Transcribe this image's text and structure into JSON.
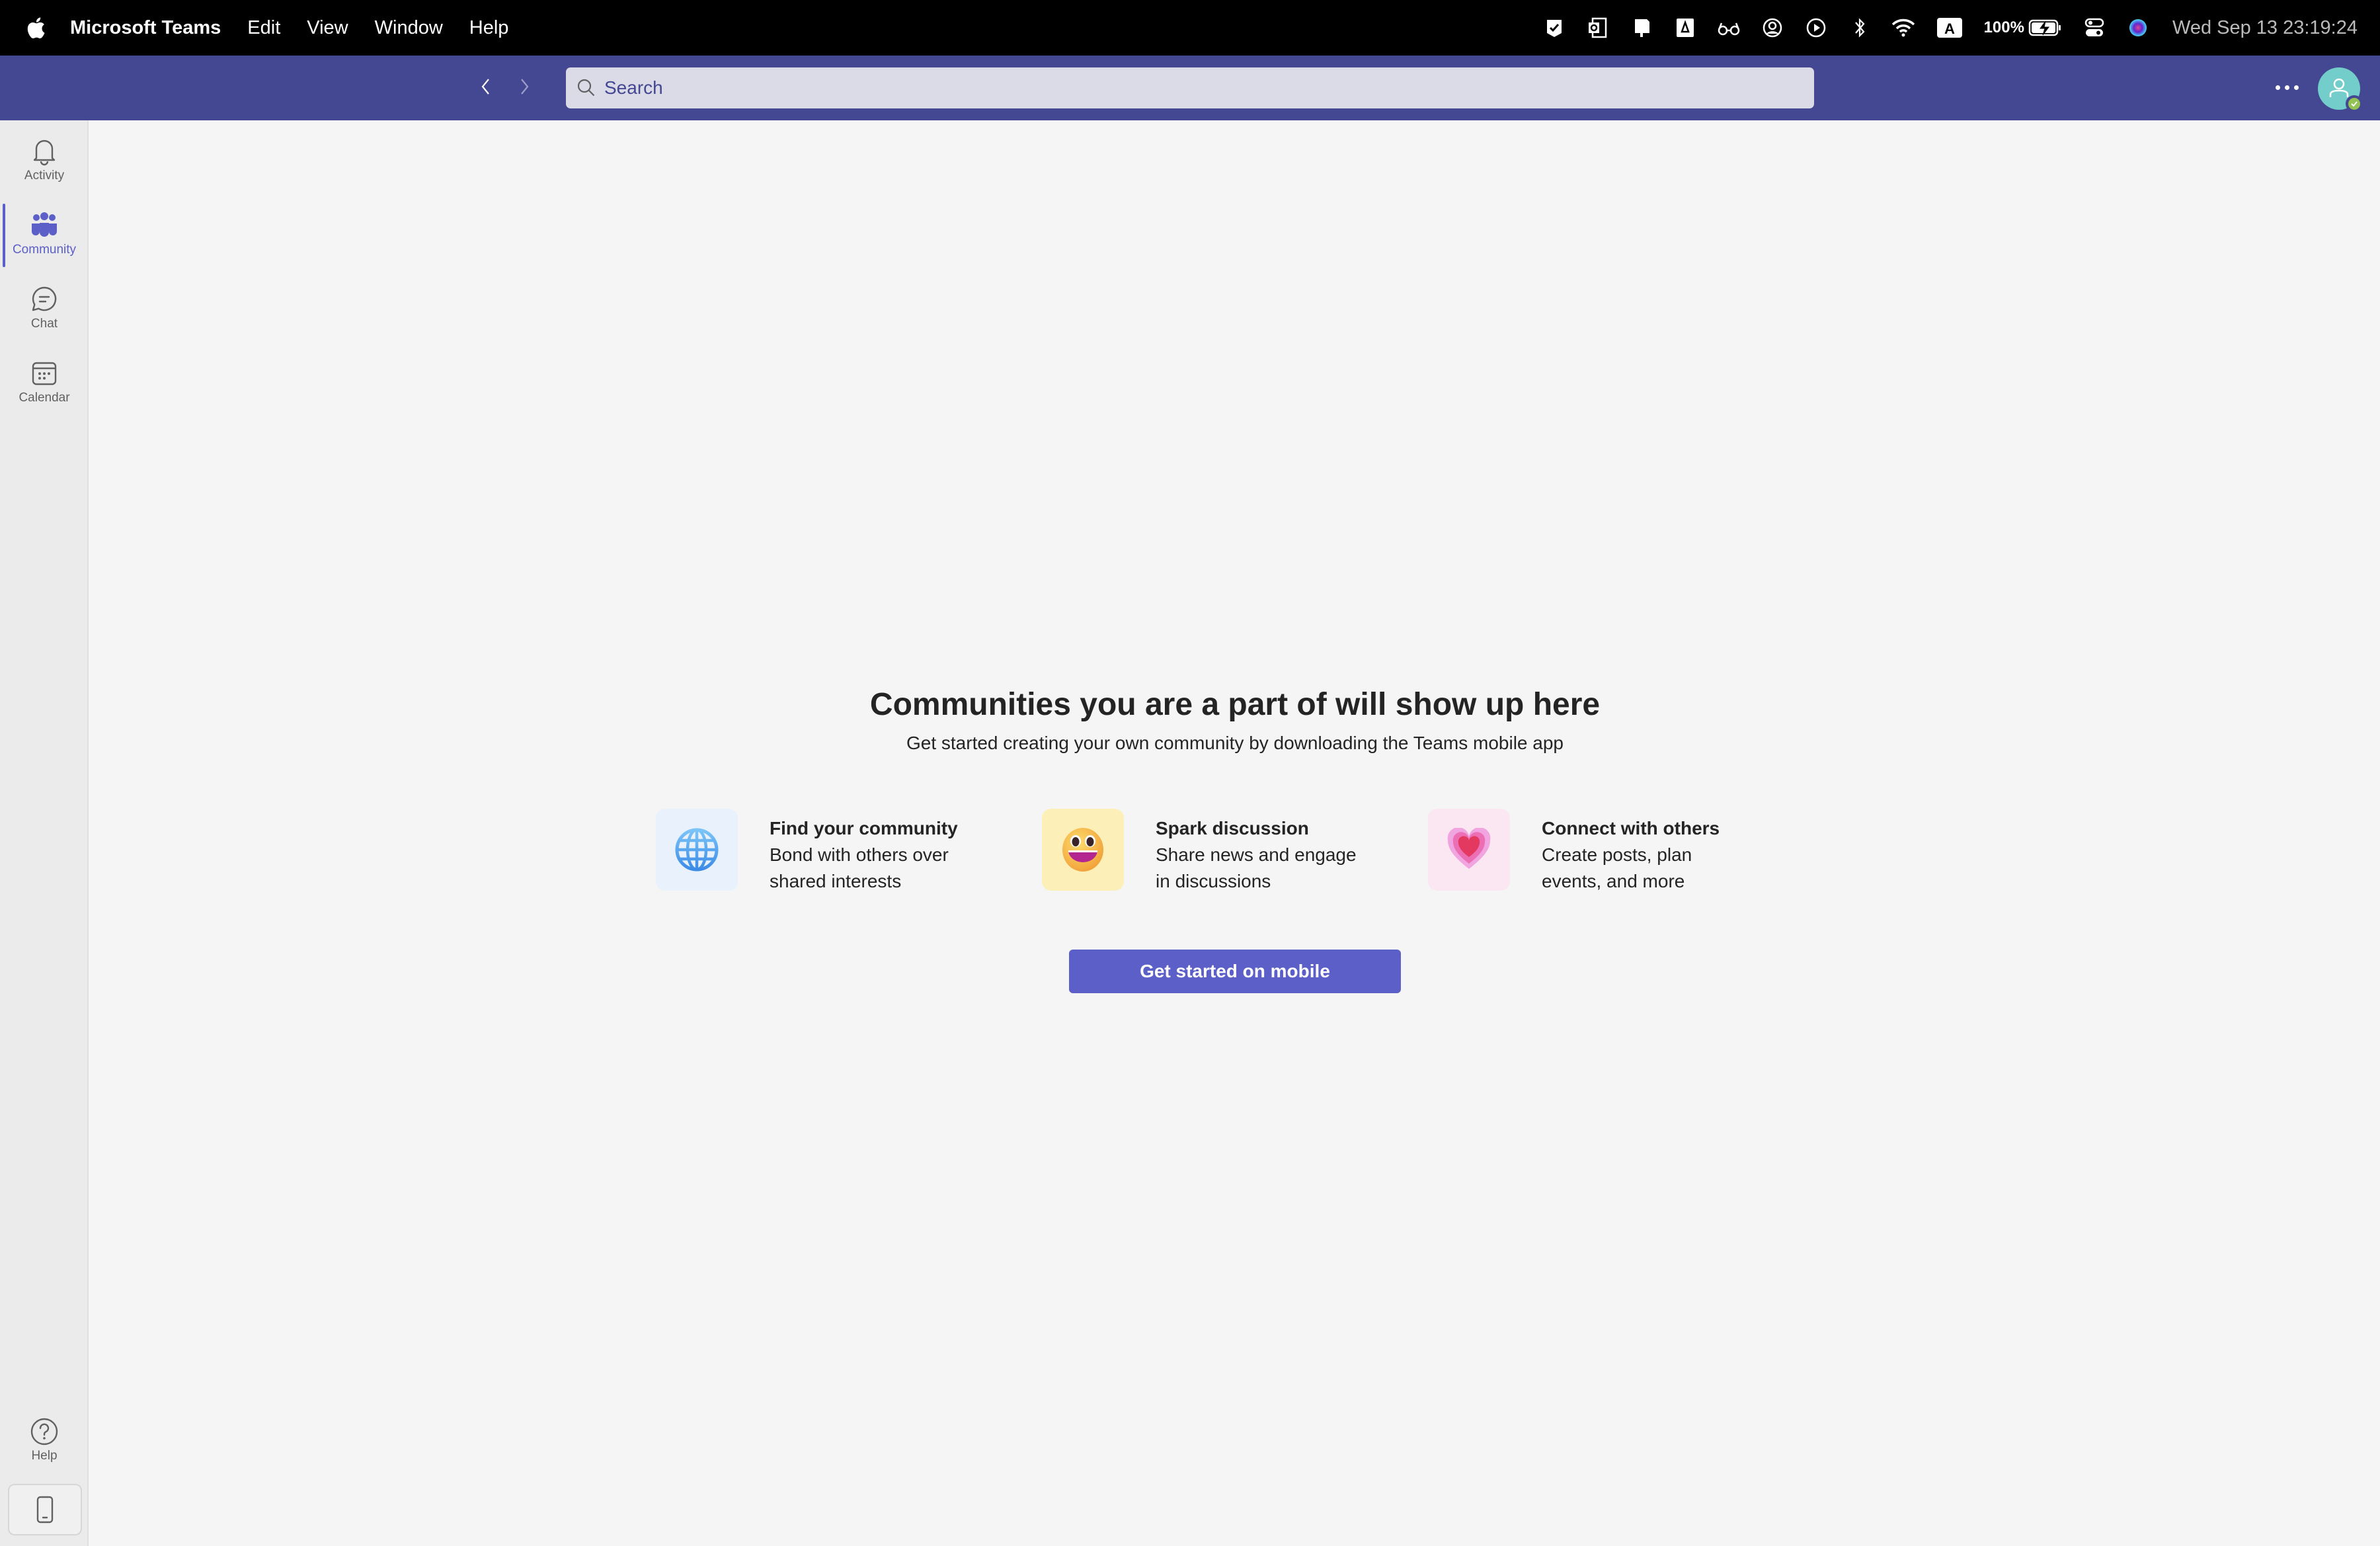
{
  "menubar": {
    "app_name": "Microsoft Teams",
    "menus": [
      "Edit",
      "View",
      "Window",
      "Help"
    ],
    "status_icons": [
      "checkmark-badge-icon",
      "outlook-icon",
      "display-icon",
      "drive-icon",
      "glasses-icon",
      "user-circle-icon",
      "play-circle-icon",
      "bluetooth-icon",
      "wifi-icon",
      "keyboard-input-icon"
    ],
    "input_source": "A",
    "battery": "100%",
    "clock": "Wed Sep 13  23:19:24"
  },
  "titlebar": {
    "search_placeholder": "Search",
    "more_label": "More options"
  },
  "rail": {
    "items": [
      {
        "label": "Activity",
        "icon": "bell-icon",
        "active": false
      },
      {
        "label": "Community",
        "icon": "community-icon",
        "active": true
      },
      {
        "label": "Chat",
        "icon": "chat-icon",
        "active": false
      },
      {
        "label": "Calendar",
        "icon": "calendar-icon",
        "active": false
      }
    ],
    "help_label": "Help"
  },
  "main": {
    "title": "Communities you are a part of will show up here",
    "subtitle": "Get started creating your own community by downloading the Teams mobile app",
    "features": [
      {
        "title": "Find your community",
        "description": "Bond with others over shared interests",
        "icon": "globe-icon",
        "tile_color": "#e8f1fc"
      },
      {
        "title": "Spark discussion",
        "description": "Share news and engage in discussions",
        "icon": "grinning-face-icon",
        "tile_color": "#fcf0b8"
      },
      {
        "title": "Connect with others",
        "description": "Create posts, plan events, and more",
        "icon": "heart-icon",
        "tile_color": "#fbe7f1"
      }
    ],
    "cta_label": "Get started on mobile"
  },
  "colors": {
    "brand": "#5b5fc7",
    "titlebar": "#444791",
    "presence_available": "#92c353"
  }
}
